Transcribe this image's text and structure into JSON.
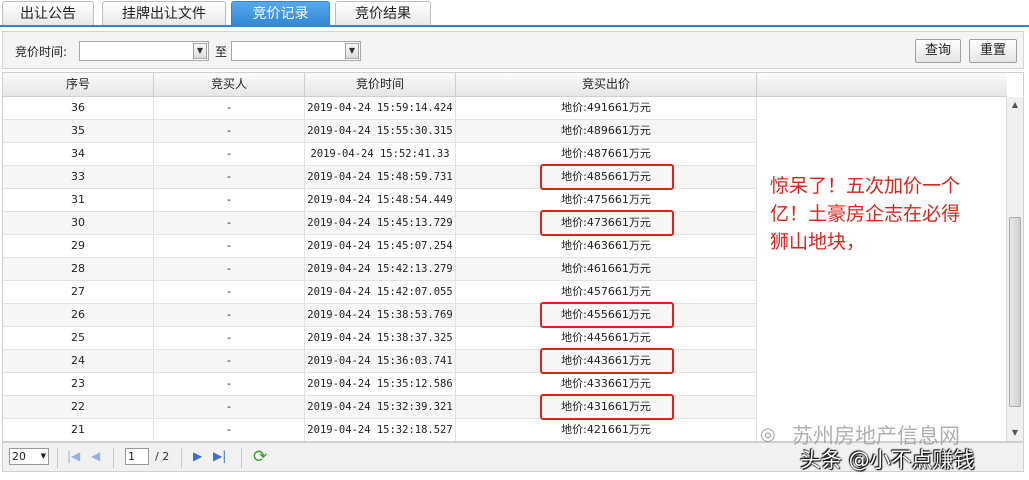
{
  "tabs": [
    {
      "label": "出让公告"
    },
    {
      "label": "挂牌出让文件"
    },
    {
      "label": "竞价记录",
      "active": true
    },
    {
      "label": "竞价结果"
    }
  ],
  "filter": {
    "time_label": "竞价时间:",
    "to_label": "至",
    "start_value": "",
    "end_value": "",
    "query_label": "查询",
    "reset_label": "重置"
  },
  "table": {
    "columns": [
      "序号",
      "竞买人",
      "竞价时间",
      "竞买出价"
    ],
    "rows": [
      {
        "no": "36",
        "bidder": "-",
        "time": "2019-04-24 15:59:14.424",
        "price": "地价:491661万元",
        "hl": false
      },
      {
        "no": "35",
        "bidder": "-",
        "time": "2019-04-24 15:55:30.315",
        "price": "地价:489661万元",
        "hl": false
      },
      {
        "no": "34",
        "bidder": "-",
        "time": "2019-04-24 15:52:41.33",
        "price": "地价:487661万元",
        "hl": false
      },
      {
        "no": "33",
        "bidder": "-",
        "time": "2019-04-24 15:48:59.731",
        "price": "地价:485661万元",
        "hl": true
      },
      {
        "no": "31",
        "bidder": "-",
        "time": "2019-04-24 15:48:54.449",
        "price": "地价:475661万元",
        "hl": false
      },
      {
        "no": "30",
        "bidder": "-",
        "time": "2019-04-24 15:45:13.729",
        "price": "地价:473661万元",
        "hl": true
      },
      {
        "no": "29",
        "bidder": "-",
        "time": "2019-04-24 15:45:07.254",
        "price": "地价:463661万元",
        "hl": false
      },
      {
        "no": "28",
        "bidder": "-",
        "time": "2019-04-24 15:42:13.279",
        "price": "地价:461661万元",
        "hl": false
      },
      {
        "no": "27",
        "bidder": "-",
        "time": "2019-04-24 15:42:07.055",
        "price": "地价:457661万元",
        "hl": false
      },
      {
        "no": "26",
        "bidder": "-",
        "time": "2019-04-24 15:38:53.769",
        "price": "地价:455661万元",
        "hl": true
      },
      {
        "no": "25",
        "bidder": "-",
        "time": "2019-04-24 15:38:37.325",
        "price": "地价:445661万元",
        "hl": false
      },
      {
        "no": "24",
        "bidder": "-",
        "time": "2019-04-24 15:36:03.741",
        "price": "地价:443661万元",
        "hl": true
      },
      {
        "no": "23",
        "bidder": "-",
        "time": "2019-04-24 15:35:12.586",
        "price": "地价:433661万元",
        "hl": false
      },
      {
        "no": "22",
        "bidder": "-",
        "time": "2019-04-24 15:32:39.321",
        "price": "地价:431661万元",
        "hl": true
      },
      {
        "no": "21",
        "bidder": "-",
        "time": "2019-04-24 15:32:18.527",
        "price": "地价:421661万元",
        "hl": false
      }
    ]
  },
  "annotation": {
    "lines": [
      "惊呆了！五次加价一个",
      "亿！土豪房企志在必得",
      "狮山地块，"
    ]
  },
  "pager": {
    "page_size": "20",
    "current_page": "1",
    "total_pages": "/ 2"
  },
  "watermark": {
    "line1": "苏州房地产信息网",
    "line2": "头条 @小不点赚钱"
  },
  "colors": {
    "accent": "#2f86d3",
    "highlight": "#d9251d"
  }
}
